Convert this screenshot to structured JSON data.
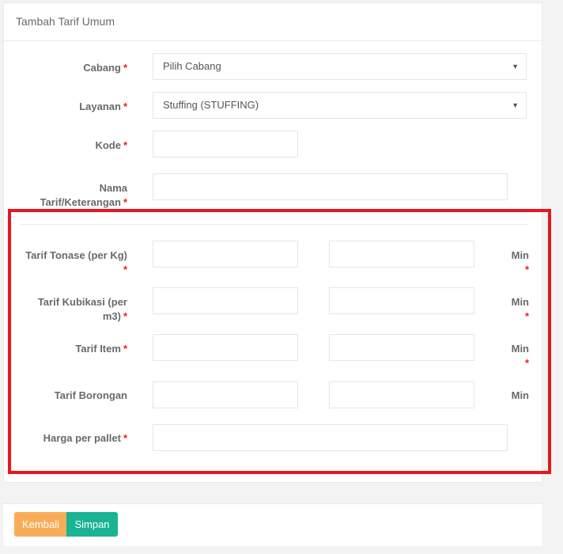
{
  "panel": {
    "title": "Tambah Tarif Umum"
  },
  "form": {
    "cabang": {
      "label": "Cabang",
      "value": "Pilih Cabang"
    },
    "layanan": {
      "label": "Layanan",
      "value": "Stuffing (STUFFING)"
    },
    "kode": {
      "label": "Kode",
      "value": ""
    },
    "nama": {
      "label_line1": "Nama",
      "label_line2": "Tarif/Keterangan",
      "value": ""
    },
    "tarif_tonase": {
      "label_line1": "Tarif Tonase (per Kg)",
      "value": "",
      "min_value": "",
      "min_label": "Min"
    },
    "tarif_kubikasi": {
      "label_line1": "Tarif Kubikasi (per",
      "label_line2": "m3)",
      "value": "",
      "min_value": "",
      "min_label": "Min"
    },
    "tarif_item": {
      "label": "Tarif Item",
      "value": "",
      "min_value": "",
      "min_label": "Min"
    },
    "tarif_borongan": {
      "label": "Tarif Borongan",
      "value": "",
      "min_value": "",
      "min_label": "Min"
    },
    "harga_pallet": {
      "label": "Harga per pallet",
      "value": ""
    },
    "required_mark": "*",
    "dropdown_icon": "caret-down-icon"
  },
  "footer": {
    "back_label": "Kembali",
    "save_label": "Simpan"
  },
  "colors": {
    "required": "#ed1c24",
    "highlight": "#e8161d",
    "back_button": "#f8ac59",
    "save_button": "#1ab394"
  }
}
